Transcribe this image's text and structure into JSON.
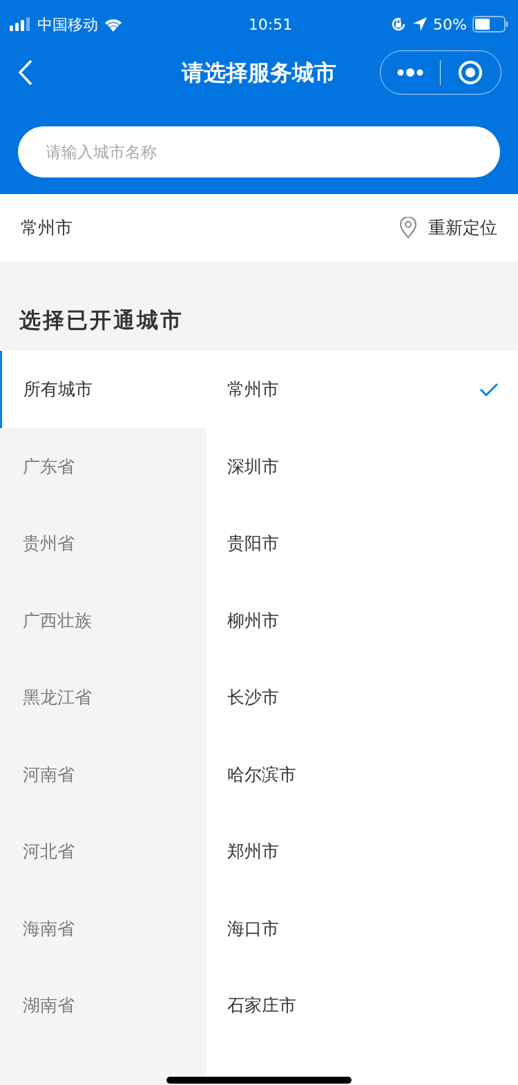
{
  "status_bar": {
    "carrier": "中国移动",
    "time": "10:51",
    "battery": "50%"
  },
  "nav": {
    "title": "请选择服务城市"
  },
  "search": {
    "placeholder": "请输入城市名称"
  },
  "location": {
    "city": "常州市",
    "relocate": "重新定位"
  },
  "section": {
    "title": "选择已开通城市"
  },
  "provinces": [
    {
      "label": "所有城市",
      "selected": true
    },
    {
      "label": "广东省",
      "selected": false
    },
    {
      "label": "贵州省",
      "selected": false
    },
    {
      "label": "广西壮族",
      "selected": false
    },
    {
      "label": "黑龙江省",
      "selected": false
    },
    {
      "label": "河南省",
      "selected": false
    },
    {
      "label": "河北省",
      "selected": false
    },
    {
      "label": "海南省",
      "selected": false
    },
    {
      "label": "湖南省",
      "selected": false
    }
  ],
  "cities": [
    {
      "label": "常州市",
      "selected": true
    },
    {
      "label": "深圳市",
      "selected": false
    },
    {
      "label": "贵阳市",
      "selected": false
    },
    {
      "label": "柳州市",
      "selected": false
    },
    {
      "label": "长沙市",
      "selected": false
    },
    {
      "label": "哈尔滨市",
      "selected": false
    },
    {
      "label": "郑州市",
      "selected": false
    },
    {
      "label": "海口市",
      "selected": false
    },
    {
      "label": "石家庄市",
      "selected": false
    }
  ]
}
